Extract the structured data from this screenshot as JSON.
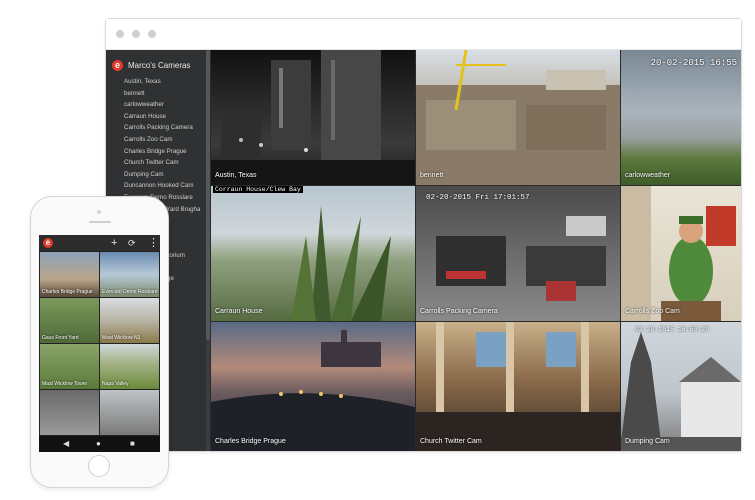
{
  "browser": {
    "dots": 3
  },
  "sidebar": {
    "title": "Marco's Cameras",
    "items": [
      "Austin, Texas",
      "bennett",
      "carlowweather",
      "Carraun House",
      "Carrolls Packing Camera",
      "Carrolls Zoo Cam",
      "Charles Bridge Prague",
      "Church Twitter Cam",
      "Dumping Cam",
      "Duncannon Hooked Cam",
      "Evercam Demo Rosslare",
      "Evercam Front Yard Brugha",
      "",
      "",
      "",
      "auditorium",
      "",
      "Bridge"
    ]
  },
  "cameras": [
    {
      "label": "Austin, Texas",
      "stamp": ""
    },
    {
      "label": "bennett",
      "stamp": ""
    },
    {
      "label": "carlowweather",
      "stamp": "20-02-2015 16:55"
    },
    {
      "label": "Carraun House",
      "stamp": "Corraun House/Clew Bay"
    },
    {
      "label": "Carrolls Packing Camera",
      "stamp": "02-20-2015 Fri 17:01:57"
    },
    {
      "label": "Carrolls Zoo Cam",
      "stamp": ""
    },
    {
      "label": "Charles Bridge Prague",
      "stamp": ""
    },
    {
      "label": "Church Twitter Cam",
      "stamp": ""
    },
    {
      "label": "Dumping Cam",
      "stamp": "02-20-2015 16:50:29"
    }
  ],
  "phone": {
    "logo": "e",
    "icons": [
      "+",
      "⟳",
      "⋮"
    ],
    "cameras": [
      "Charles Bridge Prague",
      "Evercam Demo Rosslare",
      "Gaus Front Yard",
      "Mast Wicklow N3",
      "Mast Wicklow Tower",
      "Napa Valley",
      "",
      ""
    ],
    "nav": [
      "◀",
      "●",
      "■"
    ]
  },
  "colors": {
    "brand": "#e23a2e",
    "sidebar": "#2f3133"
  }
}
